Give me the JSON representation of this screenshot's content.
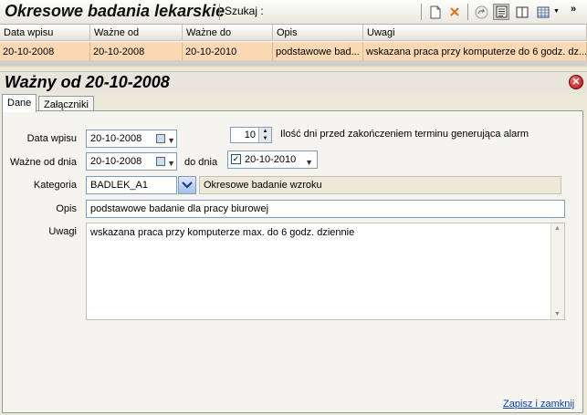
{
  "app": {
    "title": "Okresowe badania lekarskie",
    "search_label": "Szukaj :"
  },
  "toolbar_icons": [
    "new-document-icon",
    "delete-icon",
    "forward-icon",
    "notes-icon",
    "split-view-icon",
    "grid-layout-icon"
  ],
  "table": {
    "columns": [
      "Data wpisu",
      "Ważne od",
      "Ważne do",
      "Opis",
      "Uwagi"
    ],
    "rows": [
      [
        "20-10-2008",
        "20-10-2008",
        "20-10-2010",
        "podstawowe bad...",
        "wskazana praca przy komputerze do 6 godz. dz..."
      ]
    ]
  },
  "detail": {
    "title": "Ważny od 20-10-2008",
    "tabs": [
      "Dane",
      "Załączniki"
    ]
  },
  "form": {
    "data_wpisu_label": "Data wpisu",
    "data_wpisu": "20-10-2008",
    "wazne_od_label": "Ważne od dnia",
    "wazne_od": "20-10-2008",
    "do_dnia_label": "do dnia",
    "do_dnia": "20-10-2010",
    "alarm_days": "10",
    "alarm_label": "Ilość dni przed zakończeniem terminu generująca alarm",
    "kategoria_label": "Kategoria",
    "kategoria": "BADLEK_A1",
    "kategoria_desc": "Okresowe badanie wzroku",
    "opis_label": "Opis",
    "opis": "podstawowe badanie dla pracy biurowej",
    "uwagi_label": "Uwagi",
    "uwagi": "wskazana praca przy komputerze max. do 6 godz. dziennie"
  },
  "actions": {
    "save_close": "Zapisz i zamknij"
  },
  "colors": {
    "selected_row": "#fcd9b3",
    "background": "#ece9d8",
    "link": "#0a3fb3"
  }
}
